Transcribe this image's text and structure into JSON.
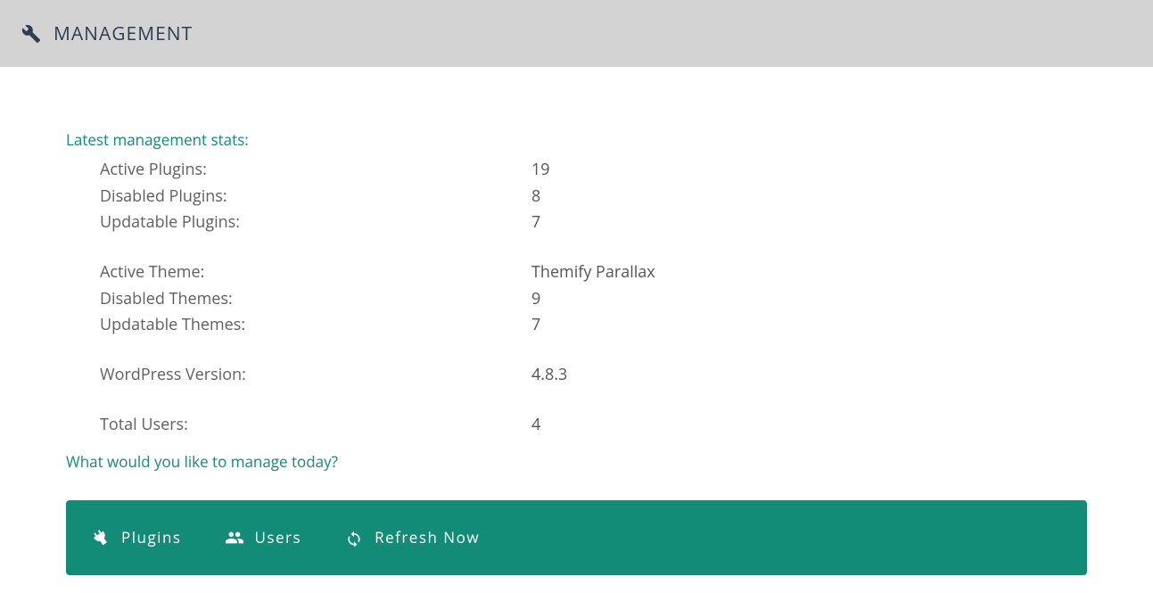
{
  "header": {
    "title": "MANAGEMENT"
  },
  "stats_header": "Latest management stats:",
  "stats": {
    "active_plugins": {
      "label": "Active Plugins:",
      "value": "19"
    },
    "disabled_plugins": {
      "label": "Disabled Plugins:",
      "value": "8"
    },
    "updatable_plugins": {
      "label": "Updatable Plugins:",
      "value": "7"
    },
    "active_theme": {
      "label": "Active Theme:",
      "value": "Themify Parallax"
    },
    "disabled_themes": {
      "label": "Disabled Themes:",
      "value": "9"
    },
    "updatable_themes": {
      "label": "Updatable Themes:",
      "value": "7"
    },
    "wp_version": {
      "label": "WordPress Version:",
      "value": "4.8.3"
    },
    "total_users": {
      "label": "Total Users:",
      "value": "4"
    }
  },
  "question": "What would you like to manage today?",
  "actions": {
    "plugins": "Plugins",
    "users": "Users",
    "refresh": "Refresh Now"
  }
}
